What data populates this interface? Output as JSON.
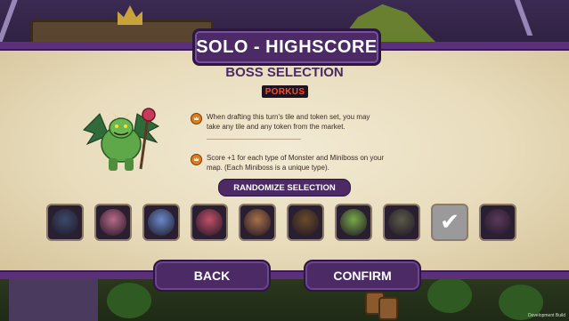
{
  "header": {
    "title": "SOLO - HIGHSCORE"
  },
  "section": {
    "title": "BOSS SELECTION"
  },
  "boss": {
    "name": "PORKUS",
    "abilities": [
      {
        "icon": "crown-icon",
        "text": "When drafting this turn's tile and token set, you may take any tile and any token from the market."
      },
      {
        "icon": "crown-icon",
        "text": "Score +1 for each type of Monster and Miniboss on your map. (Each Miniboss is a unique type)."
      }
    ]
  },
  "randomize": {
    "label": "RANDOMIZE SELECTION"
  },
  "boss_options": [
    {
      "icon": "hooded-elf-boss-icon",
      "color": "#3c4a6a",
      "selected": false
    },
    {
      "icon": "pink-brute-boss-icon",
      "color": "#b86a8a",
      "selected": false
    },
    {
      "icon": "armored-knight-boss-icon",
      "color": "#6a8ac8",
      "selected": false
    },
    {
      "icon": "robot-boss-icon",
      "color": "#c0506a",
      "selected": false
    },
    {
      "icon": "warrior-woman-boss-icon",
      "color": "#a8704a",
      "selected": false
    },
    {
      "icon": "bear-boss-icon",
      "color": "#6a4a2a",
      "selected": false
    },
    {
      "icon": "frog-king-boss-icon",
      "color": "#7aa84a",
      "selected": false
    },
    {
      "icon": "wolf-boss-icon",
      "color": "#5a5a4a",
      "selected": false
    },
    {
      "icon": "checkmark-icon",
      "color": "#9a9a9a",
      "selected": true
    },
    {
      "icon": "shadow-demon-boss-icon",
      "color": "#5a3a5a",
      "selected": false
    }
  ],
  "buttons": {
    "back": "BACK",
    "confirm": "CONFIRM"
  },
  "footer": {
    "dev_build": "Development Build"
  },
  "colors": {
    "banner": "#4b2a66",
    "boss_name": "#ff4a2a",
    "parchment": "#e8dcbc"
  }
}
